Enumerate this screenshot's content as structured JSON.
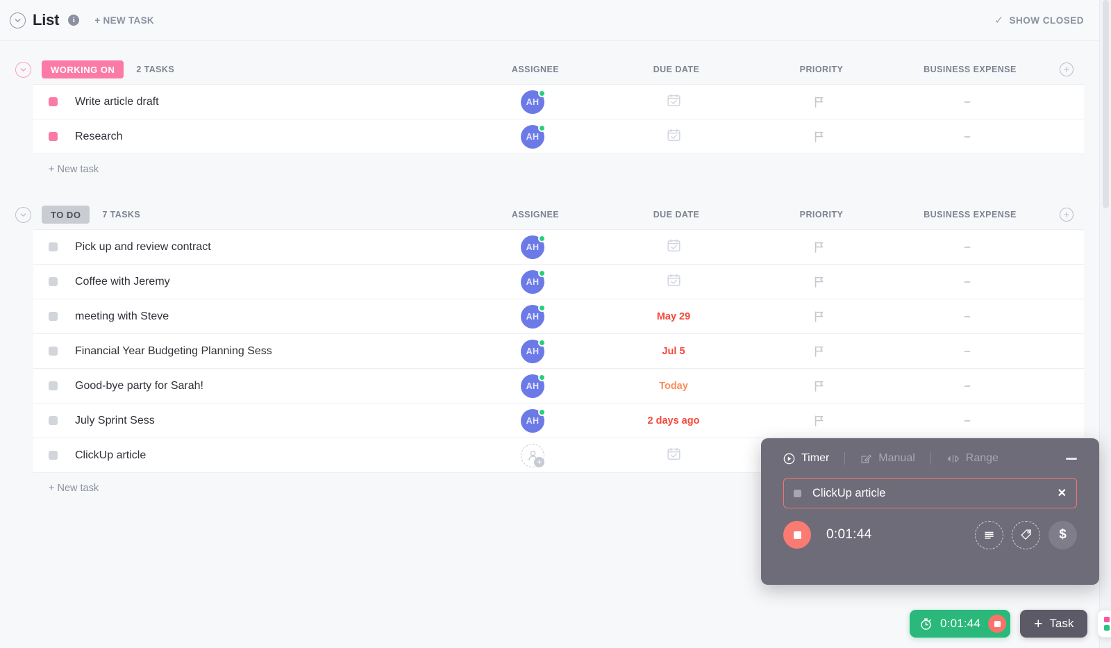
{
  "header": {
    "view_title": "List",
    "chevron_icon": "chevron-down-icon",
    "info_icon": "info-icon",
    "new_task_label": "+ NEW TASK",
    "show_closed_label": "SHOW CLOSED",
    "show_closed_icon": "check-icon"
  },
  "columns": {
    "assignee": "ASSIGNEE",
    "due_date": "DUE DATE",
    "priority": "PRIORITY",
    "business_expense": "BUSINESS EXPENSE",
    "add_column_icon": "plus-circle-icon"
  },
  "colors": {
    "working_on": "#fb7ba6",
    "to_do": "#c9ccd2",
    "overdue": "#f4483b",
    "today": "#fb8c5c",
    "avatar": "#6c7ae8",
    "presence": "#25d07d",
    "timer_green": "#2ab87b",
    "timer_red": "#f97b72",
    "panel_bg": "#6f6c79"
  },
  "groups": [
    {
      "status": "WORKING ON",
      "status_color": "#fb7ba6",
      "status_text_color": "#ffffff",
      "count_label": "2 TASKS",
      "dot_color": "#fb7ba6",
      "chevron_style": "pink",
      "new_task_label": "+ New task",
      "tasks": [
        {
          "name": "Write article draft",
          "assignee": "AH",
          "assignee_present": true,
          "due": "",
          "due_kind": "none",
          "priority": "flag-icon",
          "expense": "–"
        },
        {
          "name": "Research",
          "assignee": "AH",
          "assignee_present": true,
          "due": "",
          "due_kind": "none",
          "priority": "flag-icon",
          "expense": "–"
        }
      ]
    },
    {
      "status": "TO DO",
      "status_color": "#c9ccd2",
      "status_text_color": "#4a4d55",
      "count_label": "7 TASKS",
      "dot_color": "#d2d5da",
      "chevron_style": "gray",
      "new_task_label": "+ New task",
      "tasks": [
        {
          "name": "Pick up and review contract",
          "assignee": "AH",
          "assignee_present": true,
          "due": "",
          "due_kind": "none",
          "priority": "flag-icon",
          "expense": "–"
        },
        {
          "name": "Coffee with Jeremy",
          "assignee": "AH",
          "assignee_present": true,
          "due": "",
          "due_kind": "none",
          "priority": "flag-icon",
          "expense": "–"
        },
        {
          "name": "meeting with Steve",
          "assignee": "AH",
          "assignee_present": true,
          "due": "May 29",
          "due_kind": "overdue",
          "priority": "flag-icon",
          "expense": "–"
        },
        {
          "name": "Financial Year Budgeting Planning Sess",
          "assignee": "AH",
          "assignee_present": true,
          "due": "Jul 5",
          "due_kind": "overdue",
          "priority": "flag-icon",
          "expense": "–"
        },
        {
          "name": "Good-bye party for Sarah!",
          "assignee": "AH",
          "assignee_present": true,
          "due": "Today",
          "due_kind": "today",
          "priority": "flag-icon",
          "expense": "–"
        },
        {
          "name": "July Sprint Sess",
          "assignee": "AH",
          "assignee_present": true,
          "due": "2 days ago",
          "due_kind": "overdue",
          "priority": "flag-icon",
          "expense": "–"
        },
        {
          "name": "ClickUp article",
          "assignee": "",
          "assignee_present": false,
          "due": "",
          "due_kind": "none",
          "priority": "flag-icon",
          "expense": ""
        }
      ]
    }
  ],
  "timer_panel": {
    "tabs": [
      {
        "label": "Timer",
        "icon": "play-circle-icon",
        "active": true
      },
      {
        "label": "Manual",
        "icon": "pencil-square-icon",
        "active": false
      },
      {
        "label": "Range",
        "icon": "range-arrows-icon",
        "active": false
      }
    ],
    "minimize_icon": "minimize-icon",
    "task_name": "ClickUp article",
    "task_close_icon": "close-icon",
    "elapsed": "0:01:44",
    "stop_icon": "stop-icon",
    "actions": [
      {
        "icon": "notes-icon",
        "style": "dashed"
      },
      {
        "icon": "tag-icon",
        "style": "dashed"
      },
      {
        "icon": "dollar-icon",
        "style": "solid"
      }
    ]
  },
  "bottom_bar": {
    "timer_time": "0:01:44",
    "timer_icon": "stopwatch-icon",
    "timer_stop_icon": "stop-icon",
    "task_button_label": "Task",
    "task_button_icon": "plus-icon",
    "apps_icon": "apps-grid-icon",
    "apps_dot_colors": [
      "#f857a0",
      "#f8a417",
      "#29c47c",
      "#2f9bf5"
    ]
  }
}
